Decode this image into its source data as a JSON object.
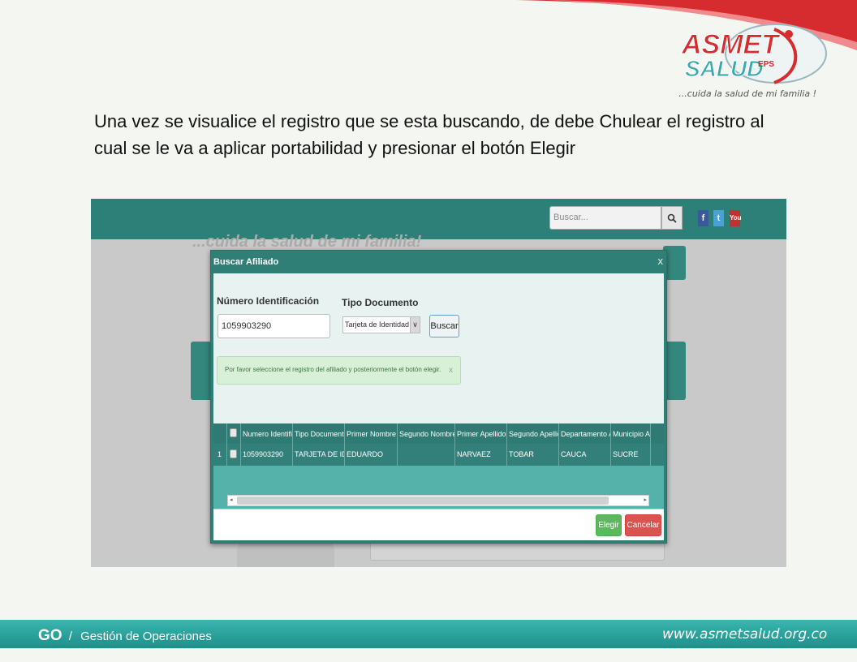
{
  "slide": {
    "instructions": "Una vez se visualice el registro que se esta buscando, de debe Chulear el registro al cual se le va a aplicar portabilidad y presionar el botón Elegir",
    "logo_line1": "ASMET",
    "logo_line2": "SALUD",
    "logo_sub": "EPS",
    "tagline": "...cuida la salud de mi familia !",
    "footer_go": "GO",
    "footer_sep": "/",
    "footer_title": "Gestión de Operaciones",
    "footer_url": "www.asmetsalud.org.co",
    "colors": {
      "brand_red": "#d62b2f",
      "brand_teal": "#2d8077",
      "footer_teal": "#1d8f89"
    }
  },
  "site": {
    "search_placeholder": "Buscar...",
    "search_icon": "magnifier-icon",
    "social": [
      "f",
      "t",
      "You"
    ],
    "slogan": "...cuida la salud de mi familia!"
  },
  "modal": {
    "title": "Buscar Afiliado",
    "close": "x",
    "id_label": "Número Identificación",
    "id_value": "1059903290",
    "tipo_label": "Tipo Documento",
    "tipo_value": "Tarjeta de Identidad",
    "tipo_arrow": "∨",
    "buscar": "Buscar",
    "alert": "Por favor seleccione el registro del afiliado y posteriormente el botón elegir.",
    "alert_close": "x",
    "columns": [
      "Numero Identifica",
      "Tipo Documento",
      "Primer Nombre",
      "Segundo Nombre",
      "Primer Apellido",
      "Segundo Apellido",
      "Departamento Afi",
      "Municipio Afili"
    ],
    "rows": [
      {
        "num": "1",
        "cells": [
          "1059903290",
          "TARJETA DE IDE",
          "EDUARDO",
          "",
          "NARVAEZ",
          "TOBAR",
          "CAUCA",
          "SUCRE"
        ]
      }
    ],
    "scroll_left": "◂",
    "scroll_right": "▸",
    "elegir": "Elegir",
    "cancelar": "Cancelar"
  }
}
